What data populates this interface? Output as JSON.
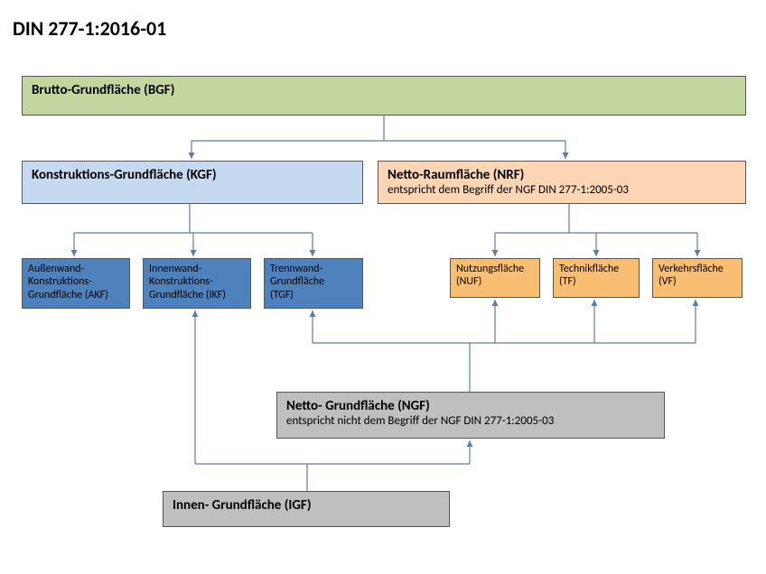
{
  "title": "DIN 277-1:2016-01",
  "bgf": {
    "label": "Brutto-Grundfläche (BGF)"
  },
  "kgf": {
    "label": "Konstruktions-Grundfläche (KGF)"
  },
  "nrf": {
    "label": "Netto-Raumfläche (NRF)",
    "sub": "entspricht dem Begriff der NGF DIN 277-1:2005-03"
  },
  "akf": {
    "l1": "Außenwand-",
    "l2": "Konstruktions-",
    "l3": "Grundfläche (AKF)"
  },
  "ikf": {
    "l1": "Innenwand-",
    "l2": "Konstruktions-",
    "l3": "Grundfläche (IKF)"
  },
  "tgf": {
    "l1": "Trennwand-",
    "l2": "Grundfläche",
    "l3": "(TGF)"
  },
  "nuf": {
    "l1": "Nutzungsfläche",
    "l2": "(NUF)"
  },
  "tf": {
    "l1": "Technikfläche",
    "l2": "(TF)"
  },
  "vf": {
    "l1": "Verkehrsfläche",
    "l2": "(VF)"
  },
  "ngf": {
    "label": "Netto- Grundfläche (NGF)",
    "sub": "entspricht nicht dem Begriff der NGF DIN 277-1:2005-03"
  },
  "igf": {
    "label": "Innen- Grundfläche (IGF)"
  },
  "colors": {
    "green": "#c4d6a0",
    "lightblue": "#c5d9f1",
    "peach": "#fcd5b4",
    "blue": "#4f81bd",
    "orange": "#f9be72",
    "grey": "#bfbfbf"
  }
}
